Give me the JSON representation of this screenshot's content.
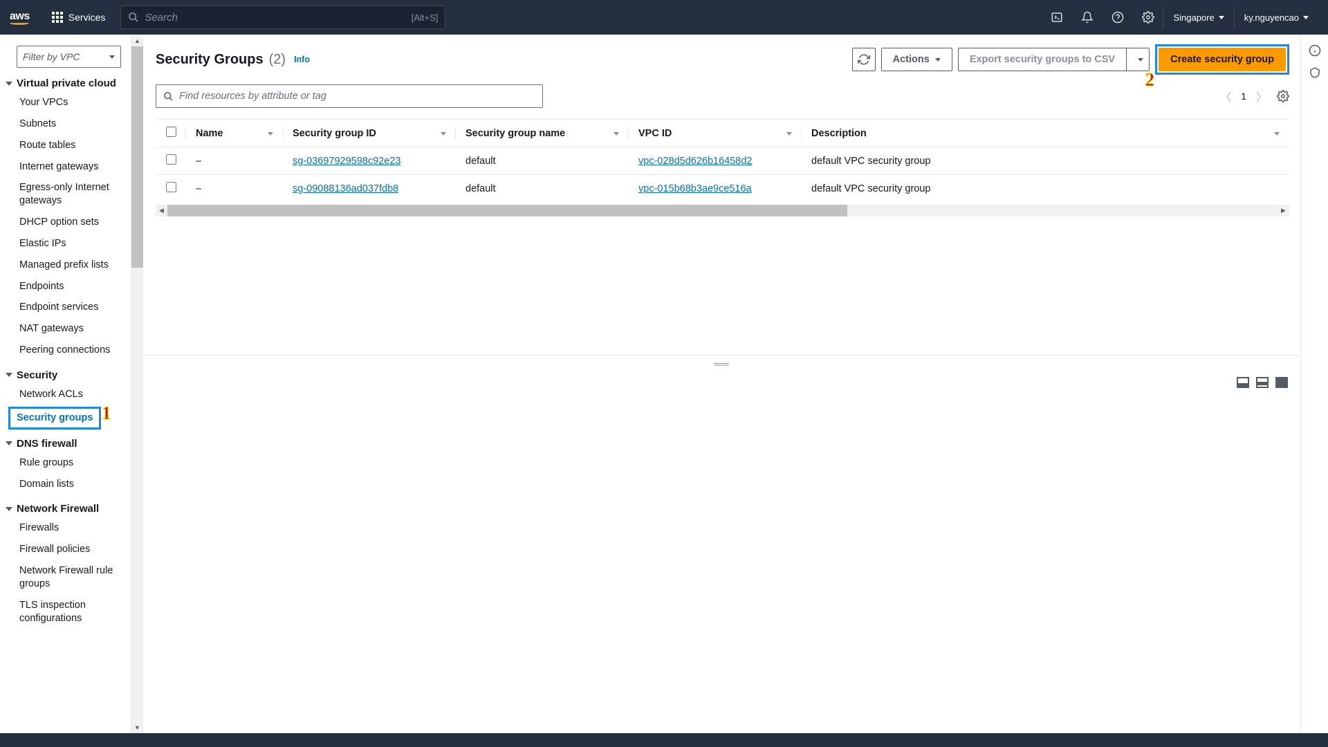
{
  "topnav": {
    "services": "Services",
    "search_placeholder": "Search",
    "search_kbd": "[Alt+S]",
    "region": "Singapore",
    "user": "ky.nguyencao"
  },
  "sidebar": {
    "filter_placeholder": "Filter by VPC",
    "sections": [
      {
        "title": "Virtual private cloud",
        "items": [
          "Your VPCs",
          "Subnets",
          "Route tables",
          "Internet gateways",
          "Egress-only Internet gateways",
          "DHCP option sets",
          "Elastic IPs",
          "Managed prefix lists",
          "Endpoints",
          "Endpoint services",
          "NAT gateways",
          "Peering connections"
        ]
      },
      {
        "title": "Security",
        "items": [
          "Network ACLs",
          "Security groups"
        ],
        "active_index": 1
      },
      {
        "title": "DNS firewall",
        "items": [
          "Rule groups",
          "Domain lists"
        ]
      },
      {
        "title": "Network Firewall",
        "items": [
          "Firewalls",
          "Firewall policies",
          "Network Firewall rule groups",
          "TLS inspection configurations"
        ]
      }
    ]
  },
  "main": {
    "title": "Security Groups",
    "count_display": "(2)",
    "info": "Info",
    "actions_label": "Actions",
    "export_label": "Export security groups to CSV",
    "create_label": "Create security group",
    "find_placeholder": "Find resources by attribute or tag",
    "page_num": "1",
    "columns": [
      "Name",
      "Security group ID",
      "Security group name",
      "VPC ID",
      "Description"
    ],
    "rows": [
      {
        "name": "–",
        "sg_id": "sg-03697929598c92e23",
        "sg_name": "default",
        "vpc_id": "vpc-028d5d626b16458d2",
        "desc": "default VPC security group"
      },
      {
        "name": "–",
        "sg_id": "sg-09088136ad037fdb8",
        "sg_name": "default",
        "vpc_id": "vpc-015b68b3ae9ce516a",
        "desc": "default VPC security group"
      }
    ]
  },
  "annotations": {
    "one": "1",
    "two": "2"
  }
}
